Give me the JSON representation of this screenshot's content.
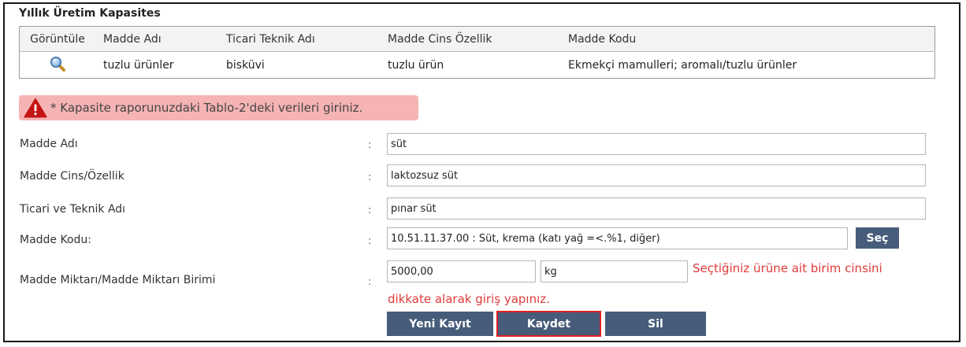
{
  "section": {
    "title": "Yıllık Üretim Kapasites"
  },
  "grid": {
    "headers": [
      "Görüntüle",
      "Madde Adı",
      "Ticari Teknik Adı",
      "Madde Cins Özellik",
      "Madde Kodu"
    ],
    "rows": [
      {
        "icon": "magnifier-icon",
        "madde_adi": "tuzlu ürünler",
        "ticari": "bisküvi",
        "cins": "tuzlu ürün",
        "kod": "Ekmekçi mamulleri; aromalı/tuzlu ürünler"
      }
    ]
  },
  "warning": {
    "icon": "warning-triangle-icon",
    "text": "* Kapasite raporunuzdaki Tablo-2'deki verileri giriniz."
  },
  "form": {
    "colon": ":",
    "madde_adi": {
      "label": "Madde Adı",
      "value": "süt"
    },
    "cins": {
      "label": "Madde Cins/Özellik",
      "value": "laktozsuz süt"
    },
    "ticari": {
      "label": "Ticari ve Teknik Adı",
      "value": "pınar süt"
    },
    "kod": {
      "label": "Madde Kodu:",
      "value": "10.51.11.37.00 : Süt, krema (katı yağ =<.%1, diğer)",
      "select_label": "Seç"
    },
    "miktar": {
      "label": "Madde Miktarı/Madde Miktarı Birimi",
      "value": "5000,00",
      "unit": "kg",
      "hint_line1": "Seçtiğiniz ürüne ait birim cinsini",
      "hint_line2": "dikkate alarak giriş yapınız."
    }
  },
  "buttons": {
    "new": "Yeni Kayıt",
    "save": "Kaydet",
    "delete": "Sil"
  },
  "colors": {
    "button": "#465c7a",
    "save_border": "#e02020",
    "warning_bg": "#f5b3b3",
    "hint": "#e03a3a"
  }
}
